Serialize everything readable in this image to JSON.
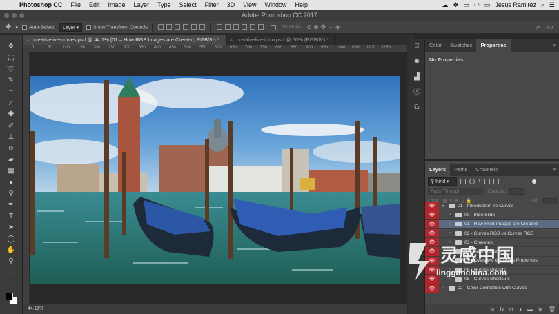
{
  "menubar": {
    "app": "Photoshop CC",
    "items": [
      "File",
      "Edit",
      "Image",
      "Layer",
      "Type",
      "Select",
      "Filter",
      "3D",
      "View",
      "Window",
      "Help"
    ],
    "user": "Jesus Ramirez"
  },
  "window": {
    "title": "Adobe Photoshop CC 2017"
  },
  "options": {
    "auto_select_label": "Auto-Select:",
    "auto_select_value": "Layer",
    "transform_label": "Show Transform Controls",
    "mode3d": "3D Mode:"
  },
  "documents": {
    "tabs": [
      {
        "label": "creativelive-curves.psd @ 44.1% (01 – How RGB Images are Created, RGB/8*) *",
        "active": true
      },
      {
        "label": "creativelive-intro.psd @ 50% (RGB/8*) *",
        "active": false
      }
    ],
    "ruler_ticks": [
      "0",
      "50",
      "100",
      "150",
      "200",
      "250",
      "300",
      "350",
      "400",
      "450",
      "500",
      "550",
      "600",
      "650",
      "700",
      "750",
      "800",
      "850",
      "900",
      "950",
      "1000",
      "1050",
      "1100",
      "1150"
    ],
    "zoom": "44.11%"
  },
  "panels": {
    "top_tabs": [
      "Color",
      "Swatches",
      "Properties"
    ],
    "properties_msg": "No Properties",
    "layer_tabs": [
      "Layers",
      "Paths",
      "Channels"
    ],
    "filter_kind": "Kind",
    "blend_mode": "Pass Through",
    "opacity_label": "Opacity:",
    "lock_label": "Lock:",
    "fill_label": "Fill:"
  },
  "layers": [
    {
      "name": "01 - Introduction To Curves",
      "indent": 0,
      "selected": false,
      "twisty": "▾"
    },
    {
      "name": "00 - Intro Slide",
      "indent": 1,
      "selected": false,
      "twisty": "›"
    },
    {
      "name": "01 - How RGB Images are Created",
      "indent": 1,
      "selected": true,
      "twisty": "›"
    },
    {
      "name": "02 - Curves RGB vs Curves RGB",
      "indent": 1,
      "selected": false,
      "twisty": "›"
    },
    {
      "name": "03 - Channels",
      "indent": 1,
      "selected": false,
      "twisty": "›"
    },
    {
      "name": "04 - Auto Options",
      "indent": 1,
      "selected": false,
      "twisty": "›"
    },
    {
      "name": "05 - Overview of Curves Properties",
      "indent": 1,
      "selected": false,
      "twisty": "›"
    },
    {
      "name": "06 - Curves Presets",
      "indent": 1,
      "selected": false,
      "twisty": "›"
    },
    {
      "name": "05 - Curves Shortcuts",
      "indent": 1,
      "selected": false,
      "twisty": "›"
    },
    {
      "name": "02 - Color Correction with Curves",
      "indent": 0,
      "selected": false,
      "twisty": "›"
    }
  ],
  "watermark": {
    "line1": "灵感中国",
    "line2": "lingganchina.com"
  },
  "colors": {
    "eye_column": "#b2262b",
    "selected_layer": "#5a6b83",
    "panel": "#484848"
  }
}
